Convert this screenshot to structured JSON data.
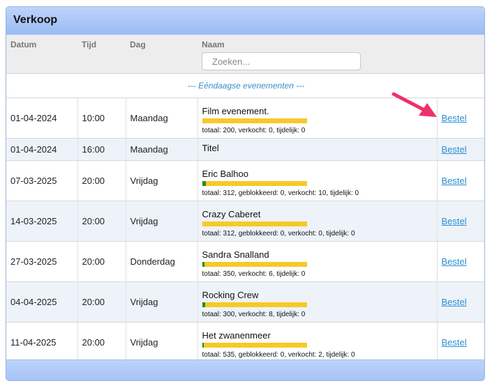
{
  "panel": {
    "title": "Verkoop"
  },
  "columns": {
    "date": "Datum",
    "time": "Tijd",
    "day": "Dag",
    "name": "Naam"
  },
  "search": {
    "placeholder": "Zoeken...",
    "value": ""
  },
  "section_label": "--- Eéndaagse evenementen ---",
  "order_label": "Bestel",
  "events": [
    {
      "date": "01-04-2024",
      "time": "10:00",
      "day": "Maandag",
      "name": "Film evenement.",
      "has_stats": true,
      "sold_fraction": 0.0,
      "stats": "totaal: 200, verkocht: 0, tijdelijk: 0"
    },
    {
      "date": "01-04-2024",
      "time": "16:00",
      "day": "Maandag",
      "name": "Titel",
      "has_stats": false
    },
    {
      "date": "07-03-2025",
      "time": "20:00",
      "day": "Vrijdag",
      "name": "Eric Balhoo",
      "has_stats": true,
      "sold_fraction": 0.032,
      "stats": "totaal: 312, geblokkeerd: 0, verkocht: 10, tijdelijk: 0"
    },
    {
      "date": "14-03-2025",
      "time": "20:00",
      "day": "Vrijdag",
      "name": "Crazy Caberet",
      "has_stats": true,
      "sold_fraction": 0.0,
      "stats": "totaal: 312, geblokkeerd: 0, verkocht: 0, tijdelijk: 0"
    },
    {
      "date": "27-03-2025",
      "time": "20:00",
      "day": "Donderdag",
      "name": "Sandra Snalland",
      "has_stats": true,
      "sold_fraction": 0.017,
      "stats": "totaal: 350, verkocht: 6, tijdelijk: 0"
    },
    {
      "date": "04-04-2025",
      "time": "20:00",
      "day": "Vrijdag",
      "name": "Rocking Crew",
      "has_stats": true,
      "sold_fraction": 0.027,
      "stats": "totaal: 300, verkocht: 8, tijdelijk: 0"
    },
    {
      "date": "11-04-2025",
      "time": "20:00",
      "day": "Vrijdag",
      "name": "Het zwanenmeer",
      "has_stats": true,
      "sold_fraction": 0.004,
      "stats": "totaal: 535, geblokkeerd: 0, verkocht: 2, tijdelijk: 0"
    }
  ],
  "colors": {
    "header_bg": "#9cbcf4",
    "bar_remaining": "#f7c928",
    "bar_sold": "#2a8a24",
    "link": "#2a8fd0",
    "arrow": "#f0306a"
  }
}
